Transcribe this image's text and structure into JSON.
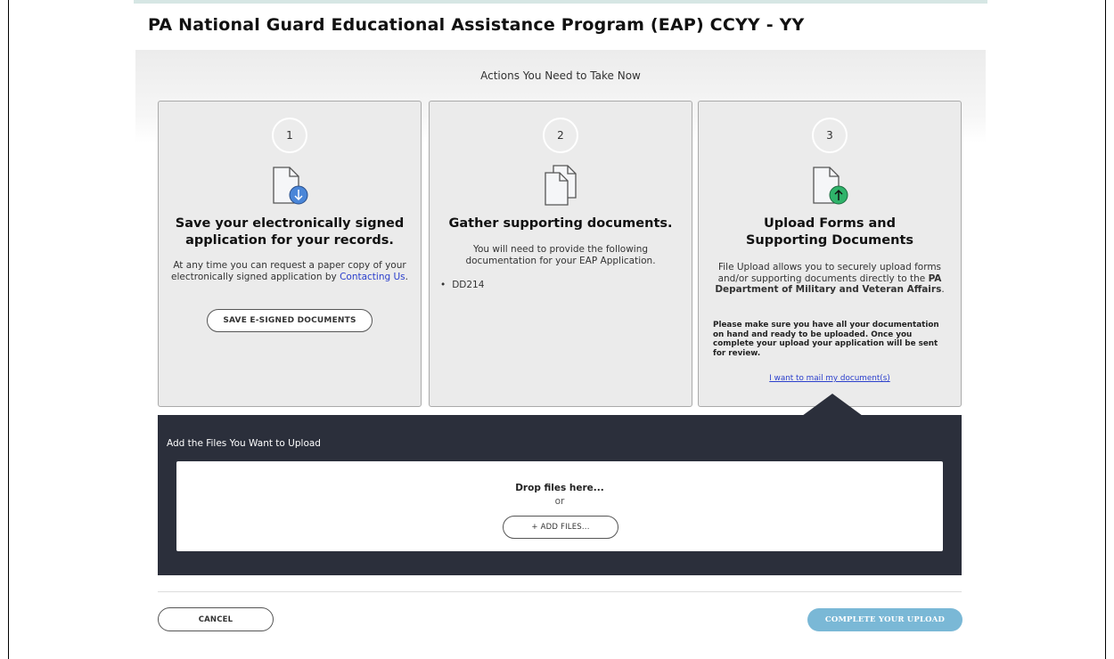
{
  "page": {
    "title": "PA National Guard Educational Assistance Program (EAP) CCYY - YY"
  },
  "actions": {
    "heading": "Actions You Need to Take Now"
  },
  "cards": [
    {
      "step": "1",
      "icon": "document-download-icon",
      "title": "Save your electronically signed application for your records.",
      "text_before_link": "At any time you can request a paper copy of your electronically signed application by",
      "link": "Contacting Us",
      "text_after_link": ".",
      "button": "SAVE E-SIGNED DOCUMENTS"
    },
    {
      "step": "2",
      "icon": "documents-stack-icon",
      "title": "Gather supporting documents.",
      "text": "You will need to provide the following documentation for your EAP Application.",
      "items": [
        "DD214"
      ]
    },
    {
      "step": "3",
      "icon": "document-upload-icon",
      "title": "Upload Forms and Supporting Documents",
      "text_before_bold": "File Upload allows you to securely upload forms and/or supporting documents directly to the",
      "bold": "PA Department of Military and Veteran Affairs",
      "text_after_bold": ".",
      "note": "Please make sure you have all your documentation on hand and ready to be uploaded. Once you complete your upload your application will be sent for review.",
      "mail_link": "I want to mail my document(s)"
    }
  ],
  "upload": {
    "heading": "Add the Files You Want to Upload",
    "drop_text": "Drop files here...",
    "or_text": "or",
    "add_button": "+ ADD FILES..."
  },
  "footer": {
    "cancel": "CANCEL",
    "complete": "COMPLETE YOUR UPLOAD"
  },
  "colors": {
    "panel": "#2b2f3b",
    "accent_blue": "#2b3fcc",
    "complete_button": "#7ab8d6",
    "download_icon": "#4a86d8",
    "upload_icon": "#2fb36a"
  }
}
